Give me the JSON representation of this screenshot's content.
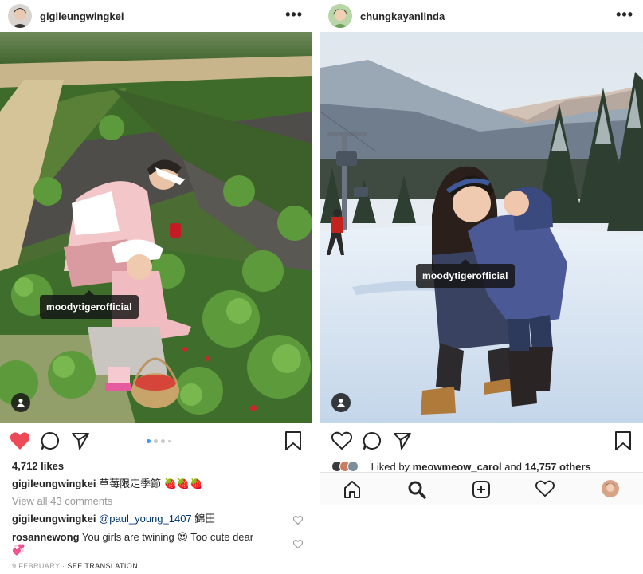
{
  "left_post": {
    "username": "gigileungwingkei",
    "more_label": "•••",
    "tag": "moodytigerofficial",
    "likes": "4,712 likes",
    "caption_user": "gigileungwingkei",
    "caption_text": "草莓限定季節 🍓🍓🍓",
    "view_comments": "View all 43 comments",
    "comments": [
      {
        "user": "gigileungwingkei",
        "mention": "@paul_young_1407",
        "text": " 錦田"
      },
      {
        "user": "rosannewong",
        "text": "You girls are twining 😍 Too cute dear",
        "text2": "💞"
      }
    ],
    "date": "9 FEBRUARY",
    "see_translation": "SEE TRANSLATION",
    "carousel": {
      "count": 4,
      "active": 0
    }
  },
  "right_post": {
    "username": "chungkayanlinda",
    "more_label": "•••",
    "tag": "moodytigerofficial",
    "liked_by_prefix": "Liked by ",
    "liked_by_user": "meowmeow_carol",
    "liked_by_suffix": " and ",
    "liked_by_others": "14,757 others"
  },
  "colors": {
    "like_red": "#ed4956",
    "text": "#262626",
    "muted": "#999999",
    "link": "#003569",
    "carousel_active": "#3897f0"
  },
  "icons": {
    "like": "heart-icon",
    "comment": "comment-icon",
    "share": "paper-plane-icon",
    "save": "bookmark-icon",
    "home": "home-icon",
    "search": "search-icon",
    "new_post": "plus-square-icon",
    "activity": "heart-icon",
    "profile": "avatar"
  }
}
